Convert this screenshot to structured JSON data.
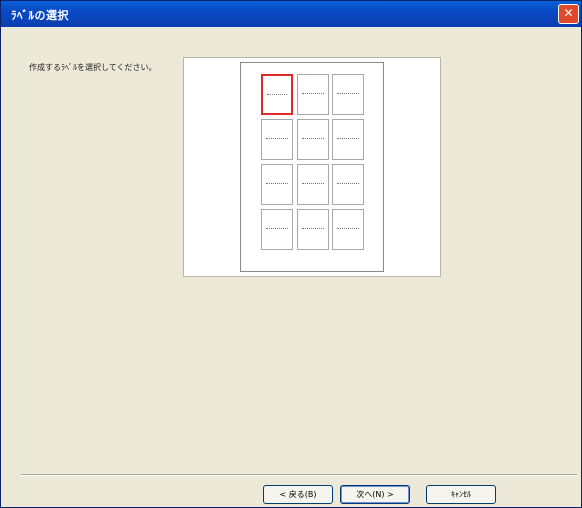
{
  "window": {
    "title": "ﾗﾍﾞﾙの選択",
    "close_glyph": "✕"
  },
  "instruction": "作成するﾗﾍﾞﾙを選択してください。",
  "labels": {
    "count": 12,
    "rows": 4,
    "cols": 3,
    "selected_index": 0
  },
  "buttons": {
    "back": "< 戻る(B)",
    "next": "次へ(N) >",
    "cancel": "ｷｬﾝｾﾙ"
  }
}
